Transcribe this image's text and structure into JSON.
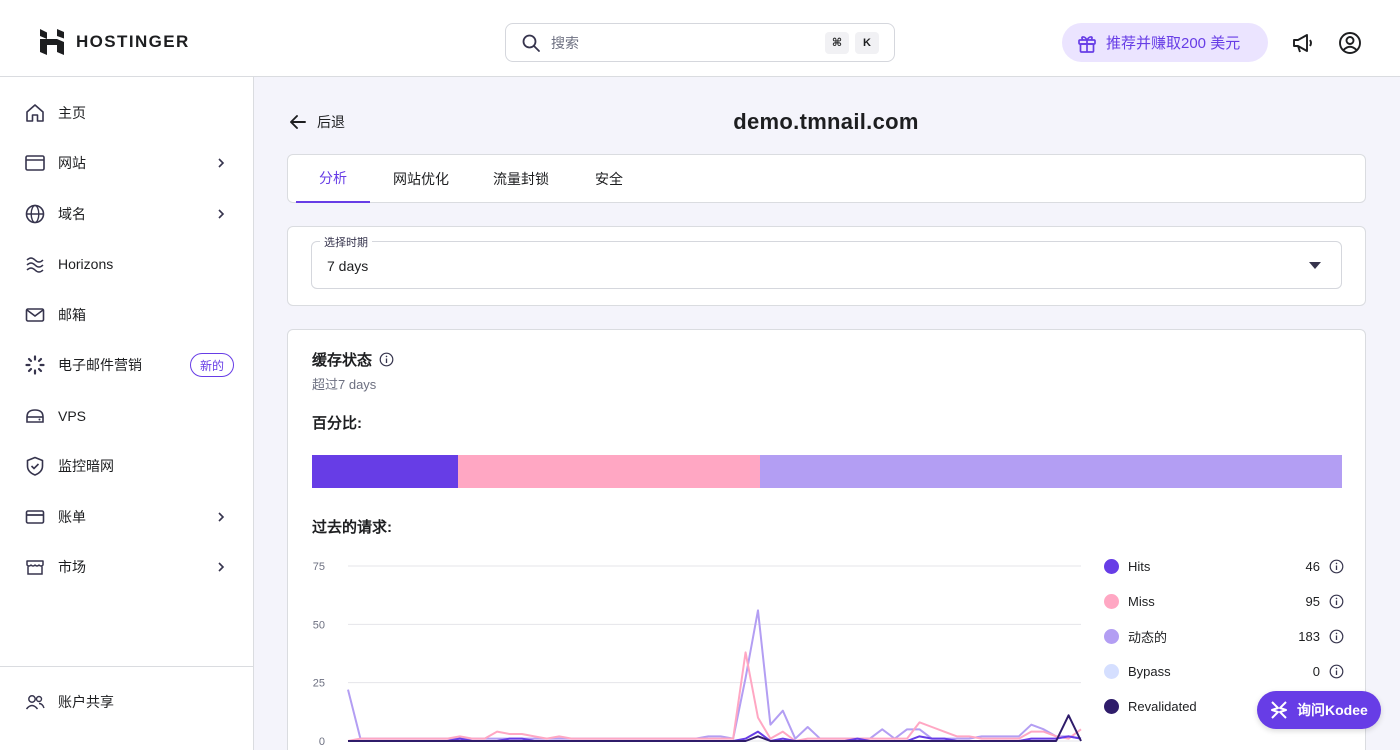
{
  "header": {
    "brand": "HOSTINGER",
    "search_placeholder": "搜索",
    "shortcut_keys": [
      "⌘",
      "K"
    ],
    "referral_label": "推荐并赚取200 美元"
  },
  "sidebar": {
    "items": [
      {
        "label": "主页",
        "icon": "home-icon",
        "has_chevron": false
      },
      {
        "label": "网站",
        "icon": "browser-icon",
        "has_chevron": true
      },
      {
        "label": "域名",
        "icon": "globe-icon",
        "has_chevron": true
      },
      {
        "label": "Horizons",
        "icon": "waves-icon",
        "has_chevron": false
      },
      {
        "label": "邮箱",
        "icon": "mail-icon",
        "has_chevron": false
      },
      {
        "label": "电子邮件营销",
        "icon": "spinner-icon",
        "has_chevron": false,
        "badge": "新的"
      },
      {
        "label": "VPS",
        "icon": "server-icon",
        "has_chevron": false
      },
      {
        "label": "监控暗网",
        "icon": "shield-icon",
        "has_chevron": false
      },
      {
        "label": "账单",
        "icon": "card-icon",
        "has_chevron": true
      },
      {
        "label": "市场",
        "icon": "store-icon",
        "has_chevron": true
      }
    ],
    "footer_item": {
      "label": "账户共享",
      "icon": "users-icon"
    }
  },
  "page": {
    "back_label": "后退",
    "title": "demo.tmnail.com",
    "tabs": [
      {
        "label": "分析",
        "active": true
      },
      {
        "label": "网站优化",
        "active": false
      },
      {
        "label": "流量封锁",
        "active": false
      },
      {
        "label": "安全",
        "active": false
      }
    ]
  },
  "period": {
    "label": "选择时期",
    "value": "7 days"
  },
  "cache": {
    "title": "缓存状态",
    "subtitle": "超过7 days",
    "percent_label": "百分比:",
    "requests_label": "过去的请求:",
    "percent_segments": [
      {
        "name": "Hits",
        "value": 46,
        "color": "#673de6"
      },
      {
        "name": "Miss",
        "value": 95,
        "color": "#ffa7c3"
      },
      {
        "name": "动态的",
        "value": 183,
        "color": "#b39ef3"
      }
    ],
    "legend": [
      {
        "name": "Hits",
        "value": "46",
        "color": "#673de6"
      },
      {
        "name": "Miss",
        "value": "95",
        "color": "#ffa7c3"
      },
      {
        "name": "动态的",
        "value": "183",
        "color": "#b39ef3"
      },
      {
        "name": "Bypass",
        "value": "0",
        "color": "#d5dfff"
      },
      {
        "name": "Revalidated",
        "value": "",
        "color": "#2f1c6a"
      }
    ]
  },
  "chart_data": {
    "type": "line",
    "title": "",
    "xlabel": "",
    "ylabel": "",
    "ylim": [
      0,
      75
    ],
    "y_ticks": [
      "75",
      "50",
      "25",
      "0"
    ],
    "grid": true,
    "x": [
      0,
      1,
      2,
      3,
      4,
      5,
      6,
      7,
      8,
      9,
      10,
      11,
      12,
      13,
      14,
      15,
      16,
      17,
      18,
      19,
      20,
      21,
      22,
      23,
      24,
      25,
      26,
      27,
      28,
      29,
      30,
      31,
      32,
      33,
      34,
      35,
      36,
      37,
      38,
      39,
      40,
      41,
      42,
      43,
      44,
      45,
      46,
      47,
      48,
      49,
      50,
      51,
      52,
      53,
      54,
      55,
      56,
      57,
      58,
      59
    ],
    "series": [
      {
        "name": "动态的",
        "color": "#b39ef3",
        "values": [
          22,
          1,
          1,
          1,
          1,
          1,
          1,
          1,
          1,
          1,
          1,
          1,
          1,
          1,
          1,
          1,
          1,
          1,
          1,
          1,
          1,
          1,
          1,
          1,
          1,
          1,
          1,
          1,
          1,
          2,
          2,
          1,
          27,
          56,
          7,
          13,
          1,
          6,
          1,
          1,
          1,
          1,
          1,
          5,
          1,
          5,
          5,
          1,
          1,
          1,
          1,
          2,
          2,
          2,
          2,
          7,
          5,
          2,
          2,
          1
        ]
      },
      {
        "name": "Miss",
        "color": "#ffa7c3",
        "values": [
          0,
          1,
          1,
          1,
          1,
          1,
          1,
          1,
          1,
          2,
          1,
          1,
          4,
          3,
          3,
          2,
          1,
          2,
          1,
          1,
          1,
          1,
          1,
          1,
          1,
          1,
          1,
          1,
          1,
          1,
          1,
          1,
          38,
          10,
          1,
          4,
          0,
          1,
          1,
          1,
          1,
          1,
          1,
          1,
          1,
          1,
          8,
          6,
          4,
          2,
          2,
          1,
          1,
          1,
          1,
          4,
          4,
          2,
          1,
          5
        ]
      },
      {
        "name": "Hits",
        "color": "#673de6",
        "values": [
          0,
          0,
          0,
          0,
          0,
          0,
          0,
          0,
          0,
          1,
          0,
          0,
          0,
          1,
          1,
          0,
          0,
          0,
          0,
          0,
          0,
          0,
          0,
          0,
          0,
          0,
          0,
          0,
          0,
          0,
          0,
          0,
          1,
          4,
          0,
          1,
          0,
          0,
          0,
          0,
          0,
          1,
          0,
          0,
          0,
          0,
          2,
          1,
          1,
          0,
          0,
          0,
          0,
          0,
          0,
          1,
          1,
          1,
          2,
          1
        ]
      },
      {
        "name": "Revalidated",
        "color": "#2f1c6a",
        "values": [
          0,
          0,
          0,
          0,
          0,
          0,
          0,
          0,
          0,
          0,
          0,
          0,
          0,
          0,
          0,
          0,
          0,
          0,
          0,
          0,
          0,
          0,
          0,
          0,
          0,
          0,
          0,
          0,
          0,
          0,
          0,
          0,
          0,
          2,
          0,
          0,
          0,
          0,
          0,
          0,
          0,
          0,
          0,
          0,
          0,
          0,
          0,
          0,
          0,
          0,
          0,
          0,
          0,
          0,
          0,
          0,
          0,
          0,
          11,
          0
        ]
      }
    ]
  },
  "assistant": {
    "label": "询问Kodee"
  }
}
